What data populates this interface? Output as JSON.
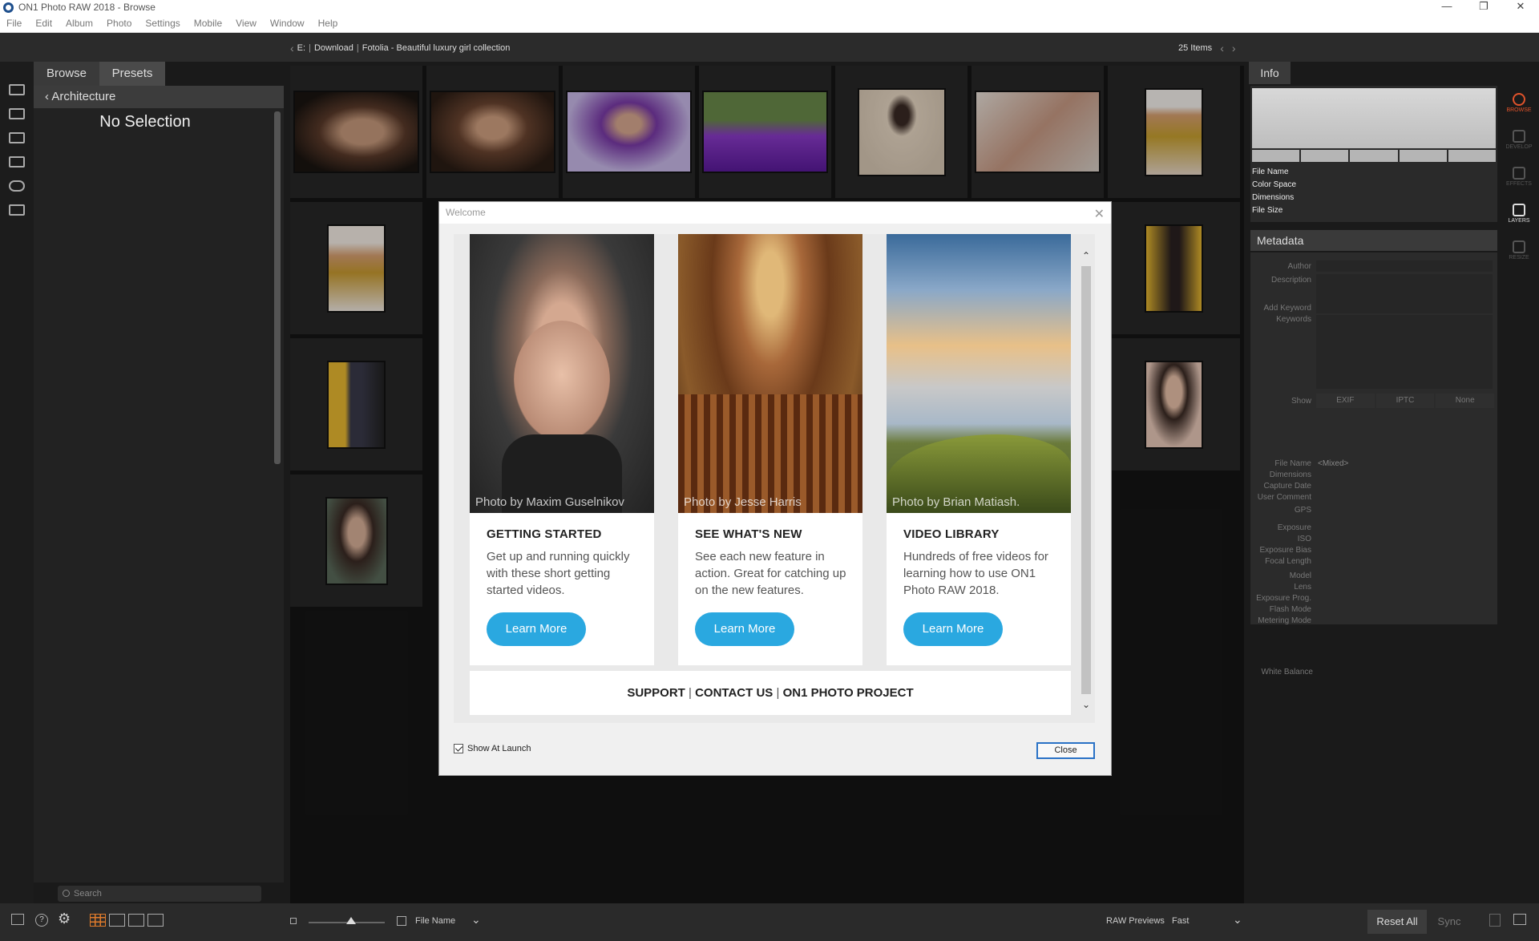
{
  "window": {
    "title": "ON1 Photo RAW 2018 - Browse"
  },
  "menu": [
    "File",
    "Edit",
    "Album",
    "Photo",
    "Settings",
    "Mobile",
    "View",
    "Window",
    "Help"
  ],
  "pathbar": {
    "drive": "E:",
    "folder": "Download",
    "collection": "Fotolia - Beautiful luxury girl collection",
    "count": "25 Items"
  },
  "left_panel": {
    "tabs": [
      "Browse",
      "Presets"
    ],
    "breadcrumb": "Architecture",
    "no_selection": "No Selection",
    "search_placeholder": "Search"
  },
  "info_panel": {
    "tab": "Info",
    "fields": [
      "File Name",
      "Color Space",
      "Dimensions",
      "File Size"
    ]
  },
  "metadata": {
    "header": "Metadata",
    "labels_top": [
      "Author",
      "Description",
      "Add Keyword",
      "Keywords"
    ],
    "show_label": "Show",
    "show_options": [
      "EXIF",
      "IPTC",
      "None"
    ],
    "file_name_value": "<Mixed>",
    "group1": [
      "File Name",
      "Dimensions",
      "Capture Date",
      "User Comment",
      "GPS"
    ],
    "group2": [
      "Exposure",
      "ISO",
      "Exposure Bias",
      "Focal Length"
    ],
    "group3": [
      "Model",
      "Lens",
      "Exposure Prog.",
      "Flash Mode",
      "Metering Mode",
      "White Balance"
    ]
  },
  "modes": [
    "BROWSE",
    "DEVELOP",
    "EFFECTS",
    "LAYERS",
    "RESIZE"
  ],
  "dialog": {
    "title": "Welcome",
    "cards": [
      {
        "credit": "Photo by Maxim Guselnikov",
        "heading": "GETTING STARTED",
        "body": "Get up and running quickly with these short getting started videos.",
        "button": "Learn More"
      },
      {
        "credit": "Photo by Jesse Harris",
        "heading": "SEE WHAT'S NEW",
        "body": "See each new feature in action. Great for catching up on the new features.",
        "button": "Learn More"
      },
      {
        "credit": "Photo by Brian Matiash.",
        "heading": "VIDEO LIBRARY",
        "body": "Hundreds of free videos for learning how to use ON1 Photo RAW 2018.",
        "button": "Learn More"
      }
    ],
    "links": [
      "SUPPORT",
      "CONTACT US",
      "ON1 PHOTO PROJECT"
    ],
    "show_at_launch": "Show At Launch",
    "close": "Close"
  },
  "bottombar": {
    "sort_label": "File Name",
    "raw_previews_label": "RAW Previews",
    "raw_previews_value": "Fast",
    "reset": "Reset All",
    "sync": "Sync"
  },
  "colors": {
    "accent_orange": "#e0532b",
    "button_blue": "#2aa8e0",
    "close_border": "#2a72c6"
  }
}
